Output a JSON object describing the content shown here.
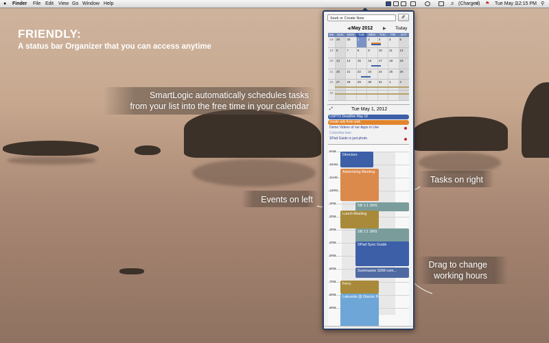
{
  "menubar": {
    "app": "Finder",
    "items": [
      "File",
      "Edit",
      "View",
      "Go",
      "Window",
      "Help"
    ],
    "battery": "(Charged)",
    "date": "Tue May 1",
    "time": "12:15 PM"
  },
  "promo": {
    "title": "FRIENDLY:",
    "subtitle": "A status bar Organizer that you can access anytime",
    "callout_smartlogic": [
      "SmartLogic automatically schedules tasks",
      "from your list into the free time in your calendar"
    ],
    "callout_events": "Events on left",
    "callout_tasks": "Tasks on right",
    "callout_drag": [
      "Drag to change",
      "working hours"
    ]
  },
  "organizer": {
    "search_placeholder": "Seek or Create New",
    "tag_icon": "tag-icon",
    "month_title": "May 2012",
    "prev": "◀",
    "next": "▶",
    "today_label": "Today",
    "weekday_headers": [
      "WK",
      "SUN",
      "MON",
      "TUE",
      "WED",
      "THU",
      "FRI",
      "SAT"
    ],
    "weeks": [
      {
        "wk": "18",
        "days": [
          "29",
          "30",
          "1",
          "2",
          "3",
          "4",
          "5"
        ]
      },
      {
        "wk": "19",
        "days": [
          "6",
          "7",
          "8",
          "9",
          "10",
          "11",
          "12"
        ]
      },
      {
        "wk": "20",
        "days": [
          "13",
          "14",
          "15",
          "16",
          "17",
          "18",
          "19"
        ]
      },
      {
        "wk": "21",
        "days": [
          "20",
          "21",
          "22",
          "23",
          "24",
          "25",
          "26"
        ]
      },
      {
        "wk": "22",
        "days": [
          "27",
          "28",
          "29",
          "30",
          "31",
          "1",
          "2"
        ]
      },
      {
        "wk": "23",
        "days": [
          "",
          "",
          "",
          "",
          "",
          "",
          ""
        ]
      }
    ],
    "selected_date": "Tue May 1, 2012",
    "tasks": [
      {
        "label": "USPTO Deadline May 16",
        "bg": "#3c5fa8",
        "color": "#ffffff",
        "dot": false
      },
      {
        "label": "create ads from web",
        "bg": "#e0852e",
        "color": "#ffffff",
        "dot": false
      },
      {
        "label": "Demo Videos of our Apps in Use",
        "bg": "transparent",
        "color": "#2b3d8f",
        "dot": true
      },
      {
        "label": "Columbia loan",
        "bg": "transparent",
        "color": "#7a8fc9",
        "dot": false
      },
      {
        "label": "SPad Guide is just photo",
        "bg": "transparent",
        "color": "#2b3d8f",
        "dot": true
      }
    ],
    "hours": [
      "9AM",
      "10AM",
      "11AM",
      "12PM",
      "1PM",
      "2PM",
      "3PM",
      "4PM",
      "5PM",
      "6PM",
      "7PM",
      "8PM",
      "9PM"
    ],
    "events": [
      {
        "label": "Directors",
        "color": "#3c5fa8"
      },
      {
        "label": "Advertising Meeting",
        "color": "#dc8a4b"
      },
      {
        "label": "SB 1:1 SRS",
        "color": "#7a9d9c"
      },
      {
        "label": "Lunch Meeting",
        "color": "#a88a3a"
      },
      {
        "label": "SB 1:1 SRS",
        "color": "#7a9d9c"
      },
      {
        "label": "SPad Sync Guide",
        "color": "#3c5fa8"
      },
      {
        "label": "Summarize SDM com...",
        "color": "#4f6aa3"
      },
      {
        "label": "Ferry",
        "color": "#a88a3a"
      },
      {
        "label": "Lakeside @ Glacier Peak",
        "color": "#6ea6d8"
      }
    ],
    "bottom": {
      "gear": "⚙▾",
      "sync": "⟳",
      "pin": "📍",
      "add": "+"
    }
  }
}
